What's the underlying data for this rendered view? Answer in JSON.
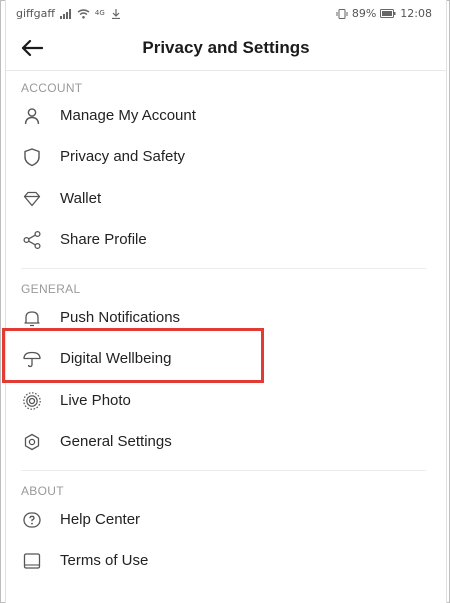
{
  "status_bar": {
    "carrier": "giffgaff",
    "network_tiny": "4G",
    "battery": "89%",
    "time": "12:08"
  },
  "header": {
    "title": "Privacy and Settings",
    "back_icon": "arrow-left-icon"
  },
  "sections": {
    "account": {
      "title": "ACCOUNT",
      "items": [
        {
          "label": "Manage My Account",
          "icon": "person-icon"
        },
        {
          "label": "Privacy and Safety",
          "icon": "shield-icon"
        },
        {
          "label": "Wallet",
          "icon": "diamond-icon"
        },
        {
          "label": "Share Profile",
          "icon": "share-icon"
        }
      ]
    },
    "general": {
      "title": "GENERAL",
      "items": [
        {
          "label": "Push Notifications",
          "icon": "bell-icon"
        },
        {
          "label": "Digital Wellbeing",
          "icon": "umbrella-icon"
        },
        {
          "label": "Live Photo",
          "icon": "live-photo-icon"
        },
        {
          "label": "General Settings",
          "icon": "gear-icon"
        }
      ]
    },
    "about": {
      "title": "ABOUT",
      "items": [
        {
          "label": "Help Center",
          "icon": "help-icon"
        },
        {
          "label": "Terms of Use",
          "icon": "document-icon"
        }
      ]
    }
  },
  "colors": {
    "highlight": "#e13b33",
    "section_header": "#9a9a9a",
    "text": "#222222"
  }
}
